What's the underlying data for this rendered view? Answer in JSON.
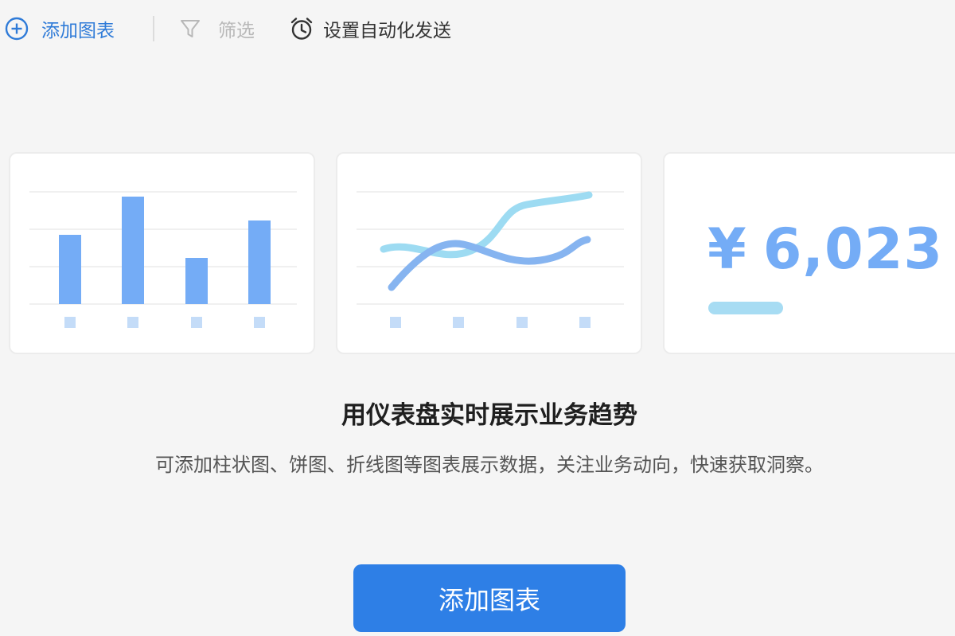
{
  "toolbar": {
    "add_chart_label": "添加图表",
    "filter_label": "筛选",
    "auto_send_label": "设置自动化发送"
  },
  "icons": {
    "add": "plus-circle-icon",
    "filter": "funnel-icon",
    "auto_send": "alarm-clock-icon"
  },
  "preview_cards": {
    "kpi": {
      "currency": "¥",
      "value": "6,023"
    }
  },
  "empty_state": {
    "title": "用仪表盘实时展示业务趋势",
    "description": "可添加柱状图、饼图、折线图等图表展示数据，关注业务动向，快速获取洞察。",
    "button_label": "添加图表"
  },
  "colors": {
    "primary": "#2e7fe6",
    "bar": "#74acf6",
    "line_light": "#9ddbf2",
    "line_dark": "#86b4f0",
    "kpi_text": "#74acf6",
    "background": "#f5f5f5"
  }
}
